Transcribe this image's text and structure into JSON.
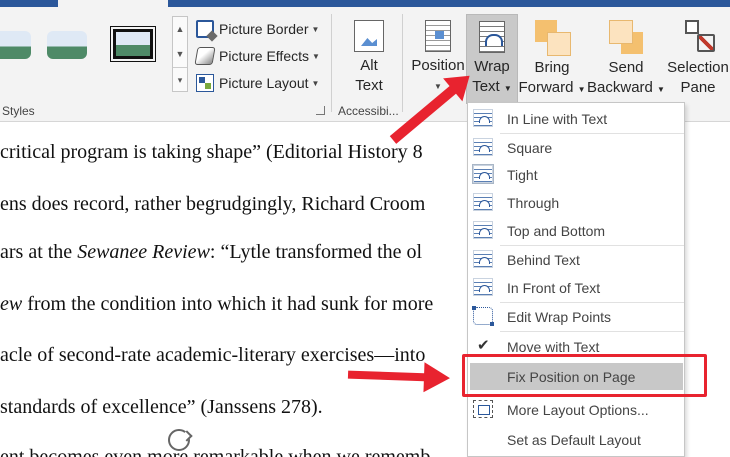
{
  "ribbon": {
    "picture_commands": [
      {
        "label": "Picture Border",
        "icon": "picture-border-icon"
      },
      {
        "label": "Picture Effects",
        "icon": "picture-effects-icon"
      },
      {
        "label": "Picture Layout",
        "icon": "picture-layout-icon"
      }
    ],
    "groups": {
      "styles": "Styles",
      "accessibility": "Accessibi..."
    },
    "buttons": {
      "alt_text": [
        "Alt",
        "Text"
      ],
      "position": [
        "Position"
      ],
      "wrap_text": [
        "Wrap",
        "Text"
      ],
      "bring_forward": [
        "Bring",
        "Forward"
      ],
      "send_backward": [
        "Send",
        "Backward"
      ],
      "selection_pane": [
        "Selection",
        "Pane"
      ]
    }
  },
  "wrap_menu": {
    "items": [
      {
        "label": "In Line with Text"
      },
      {
        "label": "Square"
      },
      {
        "label": "Tight",
        "selected": true
      },
      {
        "label": "Through"
      },
      {
        "label": "Top and Bottom"
      },
      {
        "label": "Behind Text"
      },
      {
        "label": "In Front of Text"
      },
      {
        "label": "Edit Wrap Points"
      },
      {
        "label": "Move with Text",
        "checked": true
      },
      {
        "label": "Fix Position on Page",
        "highlighted": true
      },
      {
        "label": "More Layout Options..."
      },
      {
        "label": "Set as Default Layout"
      }
    ]
  },
  "document": {
    "lines": [
      "critical program is taking shape” (Editorial History 8",
      "ens does record, rather begrudgingly, Richard Croom",
      [
        "ars at the ",
        "Sewanee Review",
        ": “Lytle transformed the ol"
      ],
      [
        "ew",
        " from the condition into which it had sunk for more"
      ],
      "acle of second-rate academic-literary exercises—into",
      "standards of excellence” (Janssens 278).",
      "ent becomes even more remarkable when we rememb"
    ]
  },
  "colors": {
    "annotation_red": "#e8232f",
    "ribbon_bg": "#f3f3f3",
    "menu_highlight": "#c8c8c8"
  }
}
